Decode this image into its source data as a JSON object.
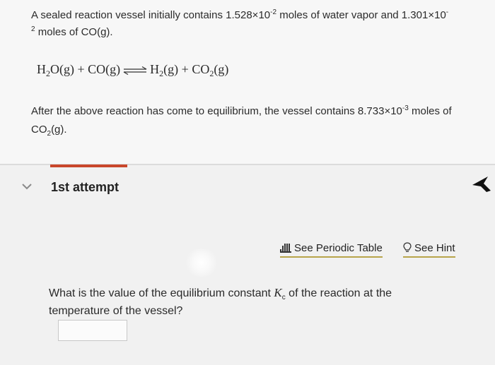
{
  "problem": {
    "line1_text": "A sealed reaction vessel initially contains 1.528×10",
    "line1_exp": "-2",
    "line1_text2": " moles of water vapor and 1.301×10",
    "line1_exp2": "-",
    "line2_exp": "2",
    "line2_text": " moles of CO(g).",
    "after_text": "After the above reaction has come to equilibrium, the vessel contains 8.733×10",
    "after_exp": "-3",
    "after_text2": " moles of",
    "line4_co": "CO",
    "line4_sub": "2",
    "line4_state": "(g)."
  },
  "equation": {
    "reactant1": "H",
    "reactant1_sub": "2",
    "reactant1_rest": "O(g)",
    "plus1": "+",
    "reactant2": "CO(g)",
    "product1": "H",
    "product1_sub": "2",
    "product1_rest": "(g)",
    "plus2": "+",
    "product2": "CO",
    "product2_sub": "2",
    "product2_rest": "(g)"
  },
  "attempt": {
    "label": "1st attempt"
  },
  "tools": {
    "periodic_label": "See Periodic Table",
    "hint_label": "See Hint"
  },
  "question": {
    "text_before": "What is the value of the equilibrium constant ",
    "k_symbol": "K",
    "k_sub": "c",
    "text_after": " of the reaction at the temperature of the vessel?"
  },
  "answer": {
    "value": ""
  },
  "colors": {
    "accent": "#c9472b",
    "link_underline": "#b8a44a"
  }
}
